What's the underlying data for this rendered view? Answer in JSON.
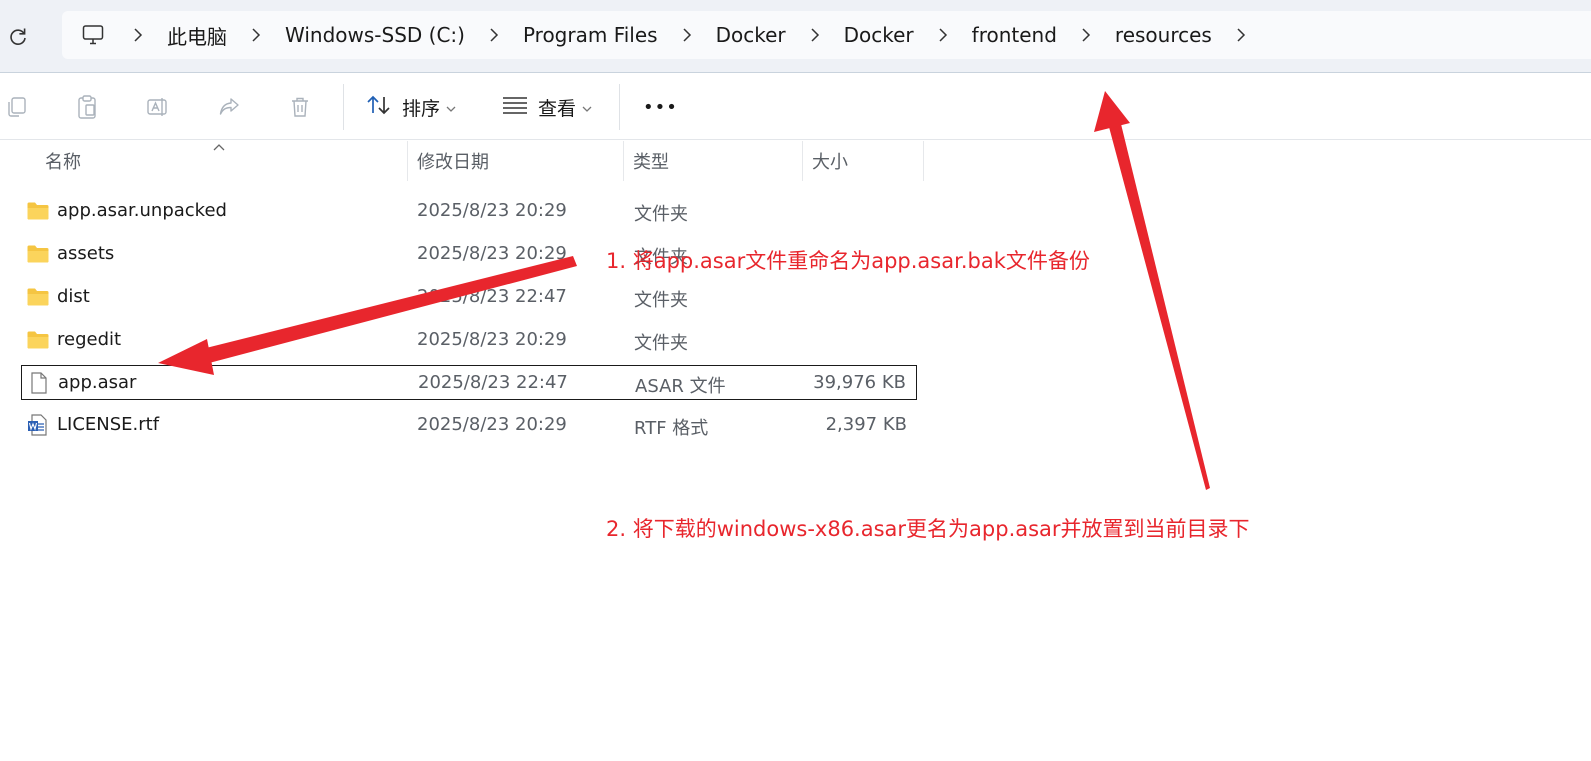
{
  "breadcrumb": {
    "items": [
      "此电脑",
      "Windows-SSD (C:)",
      "Program Files",
      "Docker",
      "Docker",
      "frontend",
      "resources"
    ]
  },
  "toolbar": {
    "sort_label": "排序",
    "view_label": "查看",
    "more_label": "•••"
  },
  "columns": {
    "name": "名称",
    "modified": "修改日期",
    "type": "类型",
    "size": "大小"
  },
  "files": [
    {
      "icon": "folder-icon",
      "name": "app.asar.unpacked",
      "modified": "2025/8/23 20:29",
      "type": "文件夹",
      "size": ""
    },
    {
      "icon": "folder-icon",
      "name": "assets",
      "modified": "2025/8/23 20:29",
      "type": "文件夹",
      "size": ""
    },
    {
      "icon": "folder-icon",
      "name": "dist",
      "modified": "2025/8/23 22:47",
      "type": "文件夹",
      "size": ""
    },
    {
      "icon": "folder-icon",
      "name": "regedit",
      "modified": "2025/8/23 20:29",
      "type": "文件夹",
      "size": ""
    },
    {
      "icon": "file-icon",
      "name": "app.asar",
      "modified": "2025/8/23 22:47",
      "type": "ASAR 文件",
      "size": "39,976 KB",
      "selected": true
    },
    {
      "icon": "word-document-icon",
      "name": "LICENSE.rtf",
      "modified": "2025/8/23 20:29",
      "type": "RTF 格式",
      "size": "2,397 KB"
    }
  ],
  "annotations": {
    "step1": "1. 将app.asar文件重命名为app.asar.bak文件备份",
    "step2": "2. 将下载的windows-x86.asar更名为app.asar并放置到当前目录下",
    "color": "#e8262d"
  },
  "colors": {
    "address_bar_bg": "#eef1f6",
    "folder": "#f5c542",
    "annotation": "#e8262d"
  }
}
